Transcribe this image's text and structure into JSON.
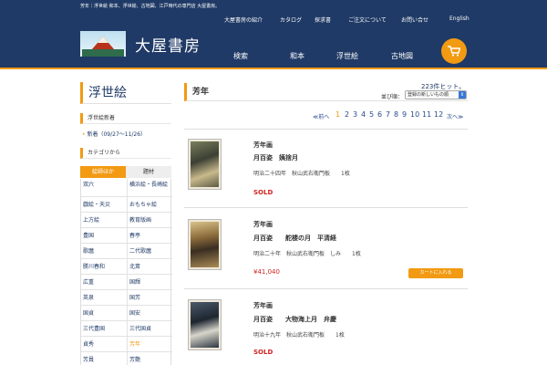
{
  "header": {
    "tagline": "芳年｜浮世絵 和本、浮世絵、古地図、江戸時代の専門店 大屋書房。",
    "site_title": "大屋書房",
    "topnav": [
      "大屋書房の紹介",
      "カタログ",
      "探求書",
      "ご注文について",
      "お問い合せ",
      "English"
    ],
    "mainnav": [
      "検索",
      "和本",
      "浮世絵",
      "古地図"
    ],
    "cart_icon": "cart-icon"
  },
  "sidebar": {
    "title": "浮世絵",
    "new_section": "浮世絵新着",
    "new_link": "新着（09/27〜11/26）",
    "category_section": "カテゴリから",
    "tabs": [
      "絵師ほか",
      "題材"
    ],
    "artists": [
      [
        "双六",
        "横浜絵・長崎絵"
      ],
      [
        "戯絵・天災",
        "おもちゃ絵"
      ],
      [
        "上方絵",
        "教育版画"
      ],
      [
        "豊国",
        "春亭"
      ],
      [
        "歌麿",
        "二代歌麿"
      ],
      [
        "勝川春和",
        "北斎"
      ],
      [
        "広重",
        "国輝"
      ],
      [
        "英泉",
        "国芳"
      ],
      [
        "国貞",
        "国安"
      ],
      [
        "三代豊国",
        "三代国貞"
      ],
      [
        "貞秀",
        "芳年"
      ],
      [
        "芳員",
        "芳艶"
      ]
    ],
    "current_artist": "芳年"
  },
  "main": {
    "title": "芳年",
    "hits_count": "223",
    "hits_suffix": "件ヒット。",
    "sort_label": "並び順：",
    "sort_value": "登録の新しいもの順",
    "pager": {
      "prev": "≪前へ",
      "current": "1",
      "pages": [
        "2",
        "3",
        "4",
        "5",
        "6",
        "7",
        "8",
        "9",
        "10",
        "11",
        "12"
      ],
      "next": "次へ≫"
    },
    "items": [
      {
        "artist": "芳年画",
        "name": "月百姿　姨捨月",
        "meta": "明治二十四年　秋山武右衛門板　　1枚",
        "status": "SOLD"
      },
      {
        "artist": "芳年画",
        "name": "月百姿　　舵楼の月　平清経",
        "meta": "明治二十年　秋山武右衛門板　しみ　　1枚",
        "price": "¥41,040",
        "button": "カートに入れる"
      },
      {
        "artist": "芳年画",
        "name": "月百姿　　大物海上月　弁慶",
        "meta": "明治十九年　秋山武右衛門板　　1枚",
        "status": "SOLD"
      }
    ]
  },
  "colors": {
    "header_bg": "#1f3a66",
    "accent": "#f29a12",
    "sold": "#d2231f",
    "link": "#2a4a8a"
  }
}
